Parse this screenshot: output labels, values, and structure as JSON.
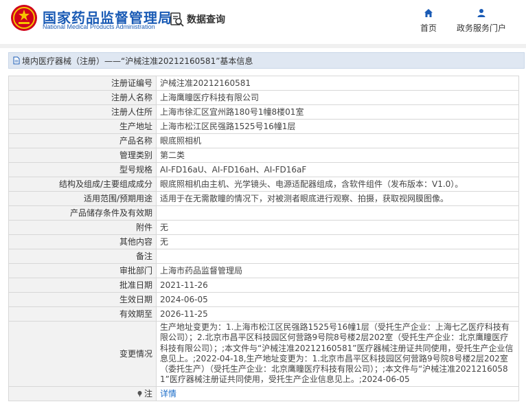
{
  "header": {
    "logo_cn": "国家药品监督管理局",
    "logo_en": "National Medical Products Administration",
    "data_query": "数据查询",
    "nav": [
      {
        "label": "首页",
        "icon": "home-icon"
      },
      {
        "label": "政务服务门户",
        "icon": "user-icon"
      }
    ]
  },
  "title": {
    "text": "境内医疗器械（注册）——“沪械注准20212160581”基本信息"
  },
  "rows": [
    {
      "label": "注册证编号",
      "value": "沪械注准20212160581"
    },
    {
      "label": "注册人名称",
      "value": "上海鹰瞳医疗科技有限公司"
    },
    {
      "label": "注册人住所",
      "value": "上海市徐汇区宜州路180号1幢8楼01室"
    },
    {
      "label": "生产地址",
      "value": "上海市松江区民强路1525号16幢1层"
    },
    {
      "label": "产品名称",
      "value": "眼底照相机"
    },
    {
      "label": "管理类别",
      "value": "第二类"
    },
    {
      "label": "型号规格",
      "value": "AI-FD16aU、AI-FD16aH、AI-FD16aF"
    },
    {
      "label": "结构及组成/主要组成成分",
      "value": "眼底照相机由主机、光学镜头、电源适配器组成，含软件组件（发布版本：V1.0）。"
    },
    {
      "label": "适用范围/预期用途",
      "value": "适用于在无需散瞳的情况下，对被测者眼底进行观察、拍摄，获取视网膜图像。"
    },
    {
      "label": "产品储存条件及有效期",
      "value": ""
    },
    {
      "label": "附件",
      "value": "无"
    },
    {
      "label": "其他内容",
      "value": "无"
    },
    {
      "label": "备注",
      "value": ""
    },
    {
      "label": "审批部门",
      "value": "上海市药品监督管理局"
    },
    {
      "label": "批准日期",
      "value": "2021-11-26"
    },
    {
      "label": "生效日期",
      "value": "2024-06-05"
    },
    {
      "label": "有效期至",
      "value": "2026-11-25"
    },
    {
      "label": "变更情况",
      "value": "生产地址变更为：1.上海市松江区民强路1525号16幢1层（受托生产企业：上海七乙医疗科技有限公司）；2.北京市昌平区科技园区何营路9号院8号楼2层202室（受托生产企业：北京鹰瞳医疗科技有限公司）；;本文件与“沪械注准20212160581”医疗器械注册证共同使用，受托生产企业信息见上。;2022-04-18,生产地址变更为：1.北京市昌平区科技园区何营路9号院8号楼2层202室（委托生产）（受托生产企业：北京鹰瞳医疗科技有限公司）；;本文件与“沪械注准2021216058 1”医疗器械注册证共同使用，受托生产企业信息见上。;2024-06-05"
    }
  ],
  "note": {
    "label": "注",
    "link": "详情"
  },
  "colors": {
    "brand_blue": "#1a5bb5",
    "emblem_red": "#d0021b",
    "link": "#1a6cc8",
    "title_bg": "#dfe7f2"
  }
}
